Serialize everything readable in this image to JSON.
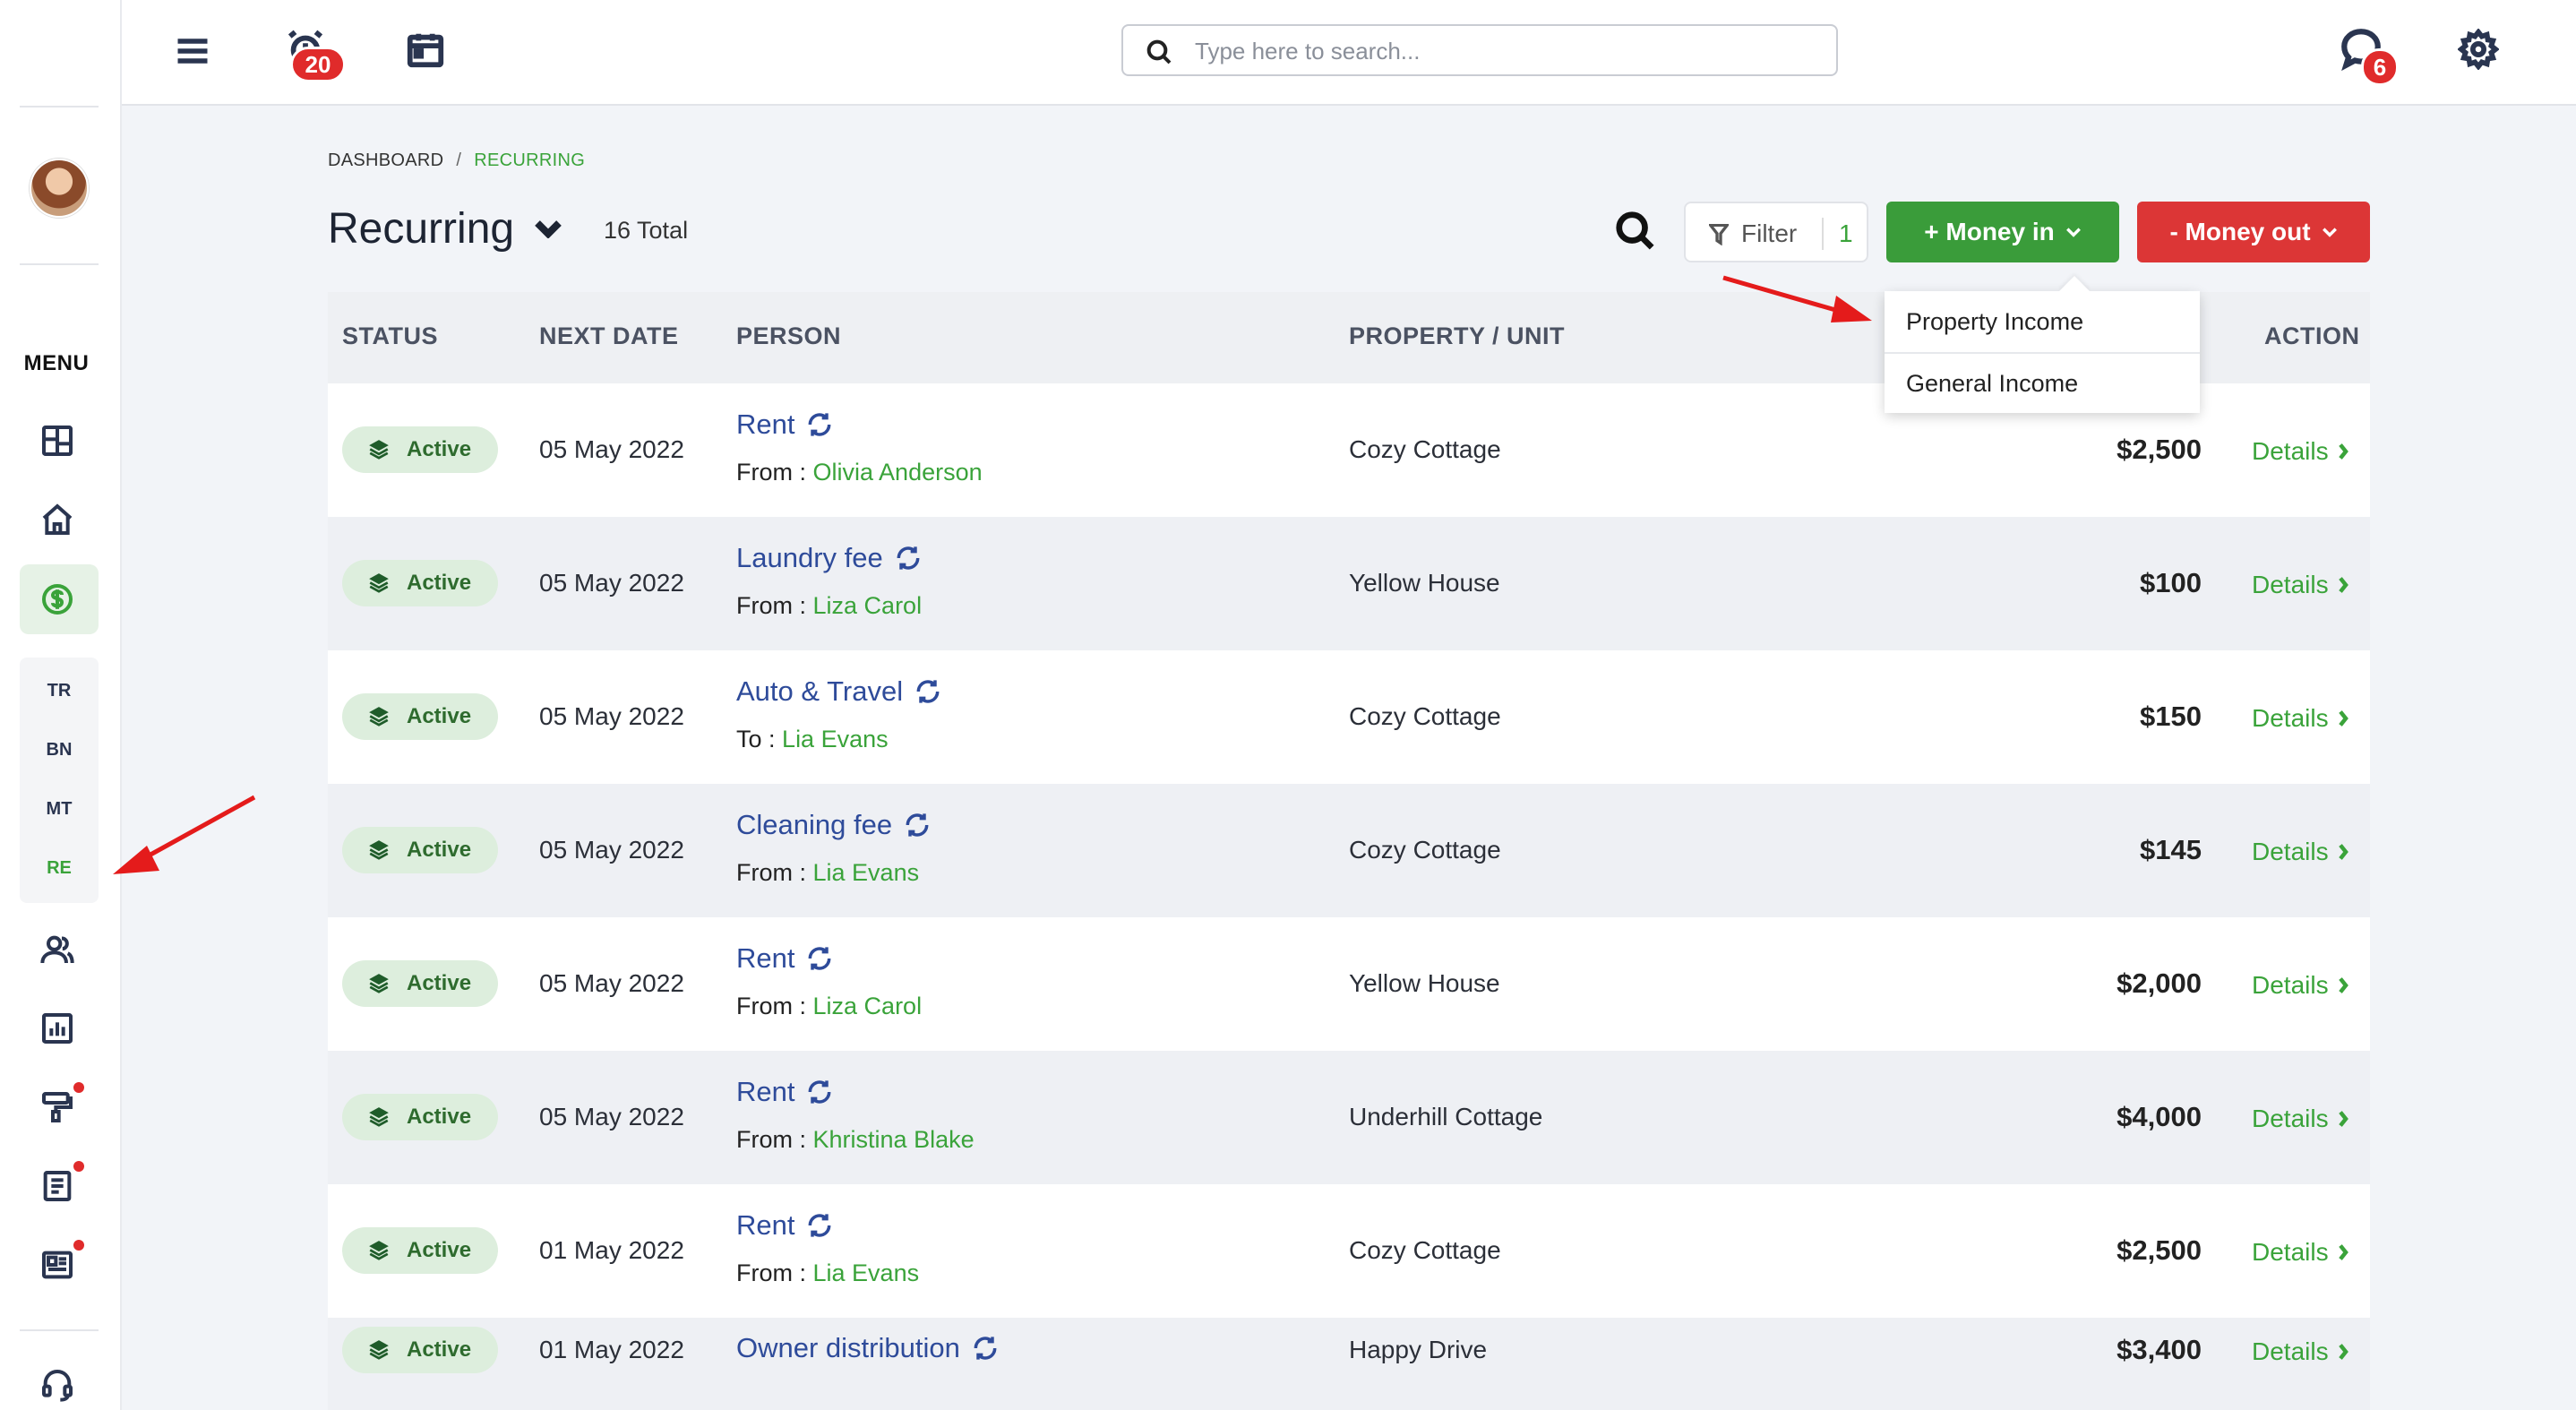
{
  "sidebar": {
    "menu_label": "MENU",
    "subnav": [
      "TR",
      "BN",
      "MT",
      "RE"
    ],
    "active_subnav": "RE"
  },
  "topbar": {
    "alarm_badge": "20",
    "chat_badge": "6",
    "search_placeholder": "Type here to search..."
  },
  "breadcrumb": {
    "root": "DASHBOARD",
    "separator": "/",
    "current": "RECURRING"
  },
  "page": {
    "title": "Recurring",
    "total": "16 Total"
  },
  "toolbar": {
    "filter_label": "Filter",
    "filter_count": "1",
    "money_in_label": "+ Money in",
    "money_out_label": "- Money out"
  },
  "money_in_menu": [
    "Property Income",
    "General Income"
  ],
  "table": {
    "headers": {
      "status": "STATUS",
      "next_date": "NEXT DATE",
      "person": "PERSON",
      "property": "PROPERTY / UNIT",
      "action": "ACTION"
    },
    "details_label": "Details",
    "rows": [
      {
        "status": "Active",
        "date": "05 May 2022",
        "title": "Rent",
        "dir": "From :",
        "person": "Olivia Anderson",
        "property": "Cozy Cottage",
        "amount": "$2,500"
      },
      {
        "status": "Active",
        "date": "05 May 2022",
        "title": "Laundry fee",
        "dir": "From :",
        "person": "Liza Carol",
        "property": "Yellow House",
        "amount": "$100"
      },
      {
        "status": "Active",
        "date": "05 May 2022",
        "title": "Auto & Travel",
        "dir": "To :",
        "person": "Lia Evans",
        "property": "Cozy Cottage",
        "amount": "$150"
      },
      {
        "status": "Active",
        "date": "05 May 2022",
        "title": "Cleaning fee",
        "dir": "From :",
        "person": "Lia Evans",
        "property": "Cozy Cottage",
        "amount": "$145"
      },
      {
        "status": "Active",
        "date": "05 May 2022",
        "title": "Rent",
        "dir": "From :",
        "person": "Liza Carol",
        "property": "Yellow House",
        "amount": "$2,000"
      },
      {
        "status": "Active",
        "date": "05 May 2022",
        "title": "Rent",
        "dir": "From :",
        "person": "Khristina Blake",
        "property": "Underhill Cottage",
        "amount": "$4,000"
      },
      {
        "status": "Active",
        "date": "01 May 2022",
        "title": "Rent",
        "dir": "From :",
        "person": "Lia Evans",
        "property": "Cozy Cottage",
        "amount": "$2,500"
      },
      {
        "status": "Active",
        "date": "01 May 2022",
        "title": "Owner distribution",
        "dir": "",
        "person": "",
        "property": "Happy Drive",
        "amount": "$3,400"
      }
    ]
  },
  "colors": {
    "accent_green": "#3a9c3a",
    "danger_red": "#dc3636",
    "link_blue": "#2e4b9a",
    "annotation_red": "#e41b1b"
  }
}
